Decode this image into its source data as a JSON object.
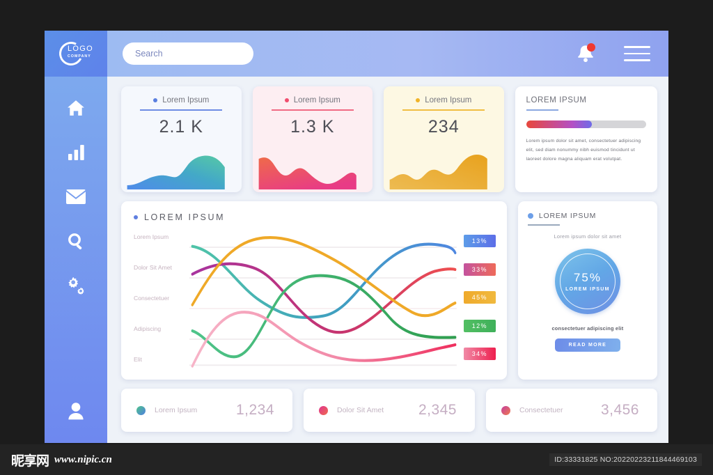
{
  "sidebar": {
    "logo": {
      "name": "LOGO",
      "sub": "COMPANY"
    },
    "items": [
      {
        "icon": "home-icon",
        "name": "home"
      },
      {
        "icon": "bar-chart-icon",
        "name": "analytics"
      },
      {
        "icon": "envelope-icon",
        "name": "messages"
      },
      {
        "icon": "search-icon",
        "name": "search"
      },
      {
        "icon": "settings-gears-icon",
        "name": "settings"
      }
    ],
    "profile": {
      "icon": "user-icon",
      "name": "profile"
    }
  },
  "topbar": {
    "search_placeholder": "Search",
    "search_value": "",
    "notifications_icon": "bell-icon",
    "has_notification": true,
    "menu_icon": "hamburger-menu-icon"
  },
  "stat_cards": [
    {
      "label": "Lorem Ipsum",
      "value": "2.1 K",
      "accent": "#5a7fe0",
      "bg": "#f5f8fd",
      "spark_from": "#4f8bea",
      "spark_to": "#56c9a5"
    },
    {
      "label": "Lorem Ipsum",
      "value": "1.3 K",
      "accent": "#f04e6e",
      "bg": "#fdeef2",
      "spark_from": "#e8554f",
      "spark_to": "#e8457f"
    },
    {
      "label": "Lorem Ipsum",
      "value": "234",
      "accent": "#f0b429",
      "bg": "#fdf8e3",
      "spark_from": "#edb843",
      "spark_to": "#e9a82a"
    }
  ],
  "info_card": {
    "title": "LOREM IPSUM",
    "progress_percent": 55,
    "progress_from": "#e8483c",
    "progress_to": "#6f6be8",
    "body": "Lorem ipsum dolor sit amet, consectetuer adipiscing elit,\nsed diam nonummy nibh euismod tincidunt ut laoreet dolore magna aliquam erat volutpat."
  },
  "chart_card": {
    "title": "LOREM IPSUM",
    "chart_data": {
      "type": "line",
      "title": "LOREM IPSUM",
      "xlabel": "",
      "ylabel": "",
      "grid": true,
      "legend_position": "left",
      "categories": [
        "Lorem Ipsum",
        "Dolor Sit Amet",
        "Consectetuer",
        "Adipiscing",
        "Elit"
      ],
      "series": [
        {
          "name": "Lorem Ipsum",
          "color_from": "#4fc4a8",
          "color_to": "#4f87e0",
          "percent": "13%",
          "values": [
            86,
            66,
            44,
            36,
            36,
            40,
            56,
            76,
            86,
            82
          ]
        },
        {
          "name": "Dolor Sit Amet",
          "color_from": "#a8339e",
          "color_to": "#ef3f5e",
          "percent": "33%",
          "values": [
            64,
            74,
            76,
            70,
            56,
            38,
            26,
            26,
            38,
            56,
            62
          ]
        },
        {
          "name": "Consectetuer",
          "color_from": "#efa928",
          "color_to": "#efa928",
          "percent": "45%",
          "values": [
            32,
            62,
            88,
            94,
            92,
            82,
            70,
            56,
            42,
            30
          ]
        },
        {
          "name": "Adipiscing",
          "color_from": "#4fc48a",
          "color_to": "#2f9e4f",
          "percent": "12%",
          "values": [
            22,
            14,
            6,
            8,
            28,
            54,
            66,
            68,
            62,
            46,
            26,
            18
          ]
        },
        {
          "name": "Elit",
          "color_from": "#f7b4c8",
          "color_to": "#ef2f5e",
          "percent": "34%",
          "values": [
            2,
            22,
            34,
            36,
            30,
            22,
            12,
            8,
            8,
            12,
            20
          ]
        }
      ],
      "badges": [
        {
          "label": "13%",
          "from": "#5d9ce8",
          "to": "#5c6ee8"
        },
        {
          "label": "33%",
          "from": "#c4539e",
          "to": "#ee6a5a"
        },
        {
          "label": "45%",
          "from": "#efaa2c",
          "to": "#f0b93e"
        },
        {
          "label": "12%",
          "from": "#52bf63",
          "to": "#3fb05a"
        },
        {
          "label": "34%",
          "from": "#f08aa6",
          "to": "#ee1f4e"
        }
      ]
    }
  },
  "donut_card": {
    "title": "LOREM IPSUM",
    "subtitle": "Lorem ipsum dolor sit amet",
    "percent": "75%",
    "percent_label": "LOREM IPSUM",
    "caption": "consectetuer adipiscing elit",
    "button_label": "READ MORE"
  },
  "mini_cards": [
    {
      "label": "Lorem Ipsum",
      "value": "1,234",
      "dot_from": "#4fc48a",
      "dot_to": "#4f7fe0"
    },
    {
      "label": "Dolor Sit Amet",
      "value": "2,345",
      "dot_from": "#e0348e",
      "dot_to": "#ef6a4f"
    },
    {
      "label": "Consectetuer",
      "value": "3,456",
      "dot_from": "#c43f9e",
      "dot_to": "#ef7a4f"
    }
  ],
  "footer": {
    "watermark_cn": "昵享网",
    "watermark_url": "www.nipic.cn",
    "id_text": "ID:33331825 NO:20220223211844469103"
  }
}
